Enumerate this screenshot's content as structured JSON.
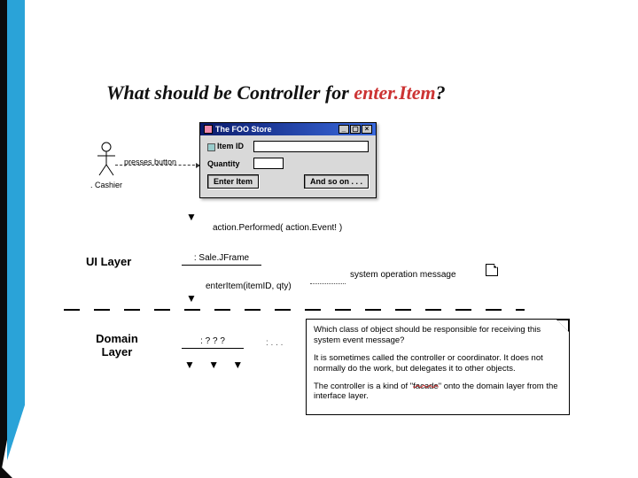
{
  "title": {
    "prefix": "What should be Controller for ",
    "highlight": "enter.Item",
    "suffix": "?"
  },
  "foo_window": {
    "title": "The FOO Store",
    "item_id_label": "Item ID",
    "quantity_label": "Quantity",
    "item_id_value": "",
    "quantity_value": "",
    "enter_button": "Enter Item",
    "more_button": "And so on . . ."
  },
  "actor": {
    "label": ". Cashier",
    "action": "presses button"
  },
  "messages": {
    "action_performed": "action.Performed( action.Event! )",
    "enter_item": "enterItem(itemID, qty)",
    "system_op": "system operation message"
  },
  "layers": {
    "ui": "UI Layer",
    "domain": "Domain\nLayer",
    "sale_jframe": ": Sale.JFrame",
    "unknown": ": ? ? ?"
  },
  "note": {
    "p1": "Which class of object should be responsible for receiving this system event message?",
    "p2": "It is sometimes called the controller or coordinator. It does not normally do the work, but delegates it to other objects.",
    "p3_a": "The controller is a kind of \"",
    "p3_facade": "facade",
    "p3_b": "\" onto the domain layer from the interface layer."
  },
  "arrows": {
    "down": "▼"
  }
}
